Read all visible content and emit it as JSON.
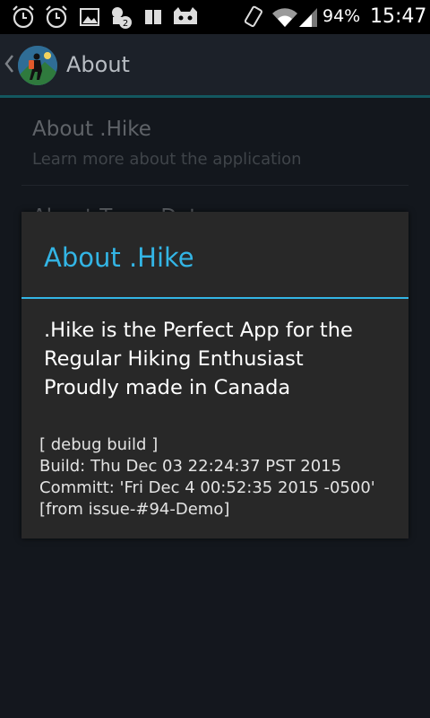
{
  "status_bar": {
    "icons": [
      "alarm-icon",
      "alarm-icon",
      "image-icon",
      "usb-debug-icon",
      "sd-card-icon",
      "cyanogen-icon",
      "rotate-icon",
      "wifi-icon",
      "signal-icon"
    ],
    "notification_count": "2",
    "battery": "94%",
    "time": "15:47"
  },
  "action_bar": {
    "title": "About"
  },
  "list": {
    "items": [
      {
        "title": "About .Hike",
        "subtitle": "Learn more about the application"
      },
      {
        "title": "About Team Dot",
        "subtitle": ""
      }
    ]
  },
  "dialog": {
    "title": "About .Hike",
    "accent_color": "#33b5e5",
    "message_lines": [
      ".Hike is the Perfect App for the",
      "Regular Hiking Enthusiast",
      "Proudly made in Canada"
    ],
    "build_lines": [
      "[ debug build ]",
      "Build: Thu Dec 03 22:24:37 PST 2015",
      "Committ: 'Fri Dec 4 00:52:35 2015 -0500'",
      "[from issue-#94-Demo]"
    ]
  }
}
